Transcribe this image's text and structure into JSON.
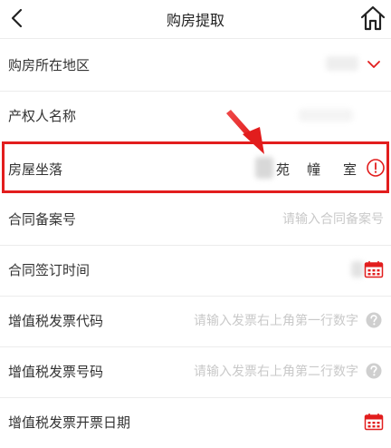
{
  "header": {
    "title": "购房提取",
    "back_icon": "chevron-left-icon",
    "home_icon": "home-icon"
  },
  "form": {
    "region": {
      "label": "购房所在地区",
      "icon": "chevron-down-icon"
    },
    "owner": {
      "label": "产权人名称"
    },
    "location": {
      "label": "房屋坐落",
      "value_parts": [
        "苑",
        "幢",
        "室"
      ],
      "icon": "alert-circle-icon"
    },
    "contract_no": {
      "label": "合同备案号",
      "placeholder": "请输入合同备案号"
    },
    "contract_date": {
      "label": "合同签订时间",
      "icon": "calendar-icon"
    },
    "invoice_code": {
      "label": "增值税发票代码",
      "placeholder": "请输入发票右上角第一行数字",
      "icon": "help-circle-icon"
    },
    "invoice_no": {
      "label": "增值税发票号码",
      "placeholder": "请输入发票右上角第二行数字",
      "icon": "help-circle-icon"
    },
    "invoice_date": {
      "label": "增值税发票开票日期",
      "icon": "calendar-icon"
    }
  },
  "colors": {
    "accent": "#e21d1d",
    "placeholder": "#c9c9c9",
    "divider": "#ececec"
  }
}
